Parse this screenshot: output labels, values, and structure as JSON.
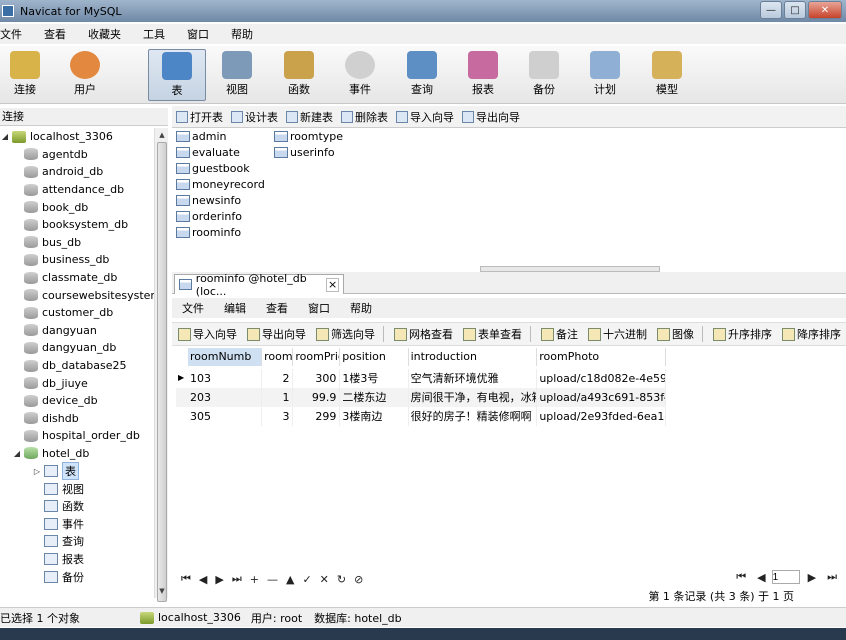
{
  "window": {
    "title": "Navicat for MySQL",
    "minimize": "—",
    "maximize": "□",
    "close": "✕"
  },
  "menu": [
    "文件",
    "查看",
    "收藏夹",
    "工具",
    "窗口",
    "帮助"
  ],
  "toolbar": [
    {
      "label": "连接",
      "icon": "connection-icon",
      "color": "#d8b34a"
    },
    {
      "label": "用户",
      "icon": "user-icon",
      "color": "#e2883f"
    },
    {
      "label": "表",
      "icon": "table-icon",
      "color": "#4d86c6",
      "active": true
    },
    {
      "label": "视图",
      "icon": "view-icon",
      "color": "#7d9bb8"
    },
    {
      "label": "函数",
      "icon": "function-icon",
      "color": "#c9a24b"
    },
    {
      "label": "事件",
      "icon": "event-icon",
      "color": "#d0d0d0"
    },
    {
      "label": "查询",
      "icon": "query-icon",
      "color": "#5e8fc4"
    },
    {
      "label": "报表",
      "icon": "report-icon",
      "color": "#c66a9f"
    },
    {
      "label": "备份",
      "icon": "backup-icon",
      "color": "#cfcfcf"
    },
    {
      "label": "计划",
      "icon": "schedule-icon",
      "color": "#8fb0d4"
    },
    {
      "label": "模型",
      "icon": "model-icon",
      "color": "#d5b15a"
    }
  ],
  "connection_label": "连接",
  "subtoolbar": [
    "打开表",
    "设计表",
    "新建表",
    "删除表",
    "导入向导",
    "导出向导"
  ],
  "tree": {
    "host": "localhost_3306",
    "databases": [
      "agentdb",
      "android_db",
      "attendance_db",
      "book_db",
      "booksystem_db",
      "bus_db",
      "business_db",
      "classmate_db",
      "coursewebsitesystem",
      "customer_db",
      "dangyuan",
      "dangyuan_db",
      "db_database25",
      "db_jiuye",
      "device_db",
      "dishdb",
      "hospital_order_db"
    ],
    "open_db": "hotel_db",
    "objects": [
      "表",
      "视图",
      "函数",
      "事件",
      "查询",
      "报表",
      "备份"
    ]
  },
  "tables_col1": [
    "admin",
    "evaluate",
    "guestbook",
    "moneyrecord",
    "newsinfo",
    "orderinfo",
    "roominfo"
  ],
  "tables_col2": [
    "roomtype",
    "userinfo"
  ],
  "tab": {
    "title": "roominfo @hotel_db (loc...",
    "close": "×"
  },
  "inner_menu": [
    "文件",
    "编辑",
    "查看",
    "窗口",
    "帮助"
  ],
  "inner_toolbar": [
    "导入向导",
    "导出向导",
    "筛选向导",
    "网格查看",
    "表单查看",
    "备注",
    "十六进制",
    "图像",
    "升序排序",
    "降序排序"
  ],
  "grid": {
    "columns": [
      "roomNumb",
      "room",
      "roomPric",
      "position",
      "introduction",
      "roomPhoto"
    ],
    "rows": [
      [
        "103",
        "2",
        "300",
        "1楼3号",
        "空气清新环境优雅",
        "upload/c18d082e-4e59-4"
      ],
      [
        "203",
        "1",
        "99.9",
        "二楼东边",
        "房间很干净，有电视，冰箱",
        "upload/a493c691-853f-42"
      ],
      [
        "305",
        "3",
        "299",
        "3楼南边",
        "很好的房子！精装修啊啊",
        "upload/2e93fded-6ea1-4"
      ]
    ]
  },
  "nav_buttons": [
    "⏮",
    "◀",
    "▶",
    "⏭",
    "+",
    "—",
    "▲",
    "✓",
    "✕",
    "↻",
    "⊘"
  ],
  "pager": {
    "first": "⏮",
    "prev": "◀",
    "page": "1",
    "next": "▶",
    "last": "⏭"
  },
  "record_status": "第 1 条记录 (共 3 条) 于 1 页",
  "status": {
    "selection": "已选择 1 个对象",
    "host": "localhost_3306",
    "user": "用户: root",
    "database": "数据库: hotel_db"
  }
}
